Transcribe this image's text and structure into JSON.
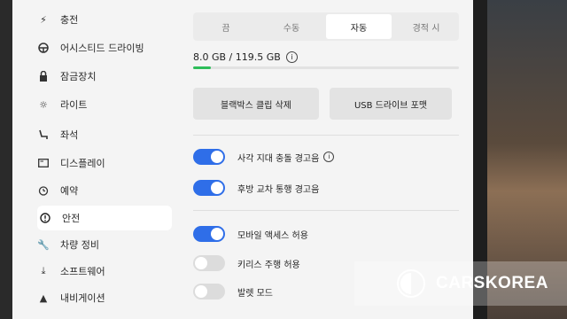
{
  "sidebar": {
    "items": [
      {
        "label": "충전",
        "icon": "bolt-icon"
      },
      {
        "label": "어시스티드 드라이빙",
        "icon": "steering-wheel-icon"
      },
      {
        "label": "잠금장치",
        "icon": "lock-icon"
      },
      {
        "label": "라이트",
        "icon": "sun-icon"
      },
      {
        "label": "좌석",
        "icon": "seat-icon"
      },
      {
        "label": "디스플레이",
        "icon": "display-icon"
      },
      {
        "label": "예약",
        "icon": "alarm-clock-icon"
      },
      {
        "label": "안전",
        "icon": "info-circle-icon"
      },
      {
        "label": "차량 정비",
        "icon": "wrench-icon"
      },
      {
        "label": "소프트웨어",
        "icon": "download-icon"
      },
      {
        "label": "내비게이션",
        "icon": "navigation-arrow-icon"
      }
    ],
    "active_index": 7
  },
  "dashcam": {
    "tabs": [
      "끔",
      "수동",
      "자동",
      "경적 시"
    ],
    "selected_tab": "자동",
    "storage_text": "8.0 GB / 119.5 GB",
    "storage_used_fraction": 0.067,
    "delete_clips_label": "블랙박스 클립 삭제",
    "format_usb_label": "USB 드라이브 포맷"
  },
  "toggles": {
    "blind_spot": {
      "label": "사각 지대 충돌 경고음",
      "on": true
    },
    "rear_cross": {
      "label": "후방 교차 통행 경고음",
      "on": true
    },
    "mobile_access": {
      "label": "모바일 액세스 허용",
      "on": true
    },
    "keyless": {
      "label": "키리스 주행 허용",
      "on": false
    },
    "valet": {
      "label": "발렛 모드",
      "on": false
    }
  },
  "watermark": {
    "text": "CARSKOREA"
  },
  "colors": {
    "toggle_on": "#2f6ee8",
    "storage_bar": "#2ebd5a"
  }
}
